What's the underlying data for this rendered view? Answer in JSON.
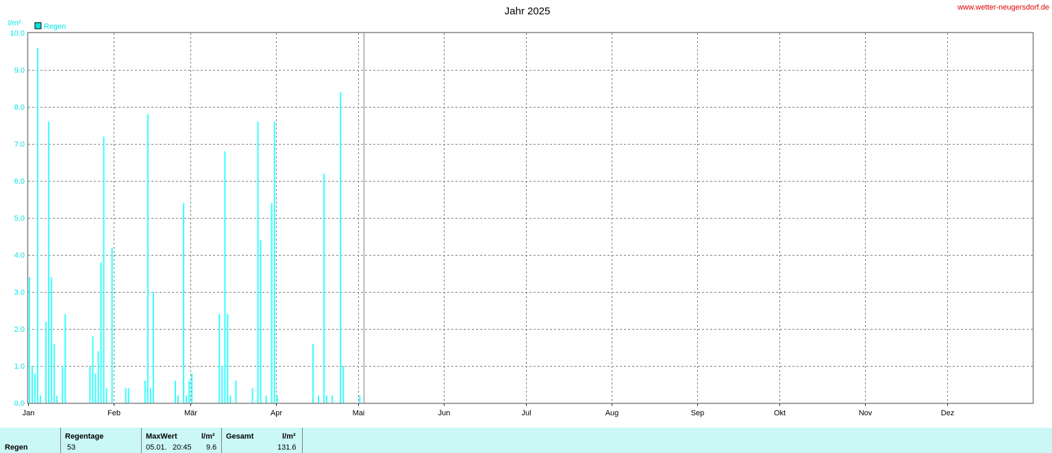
{
  "site": "www.wetter-neugersdorf.de",
  "colors": {
    "bar": "#33ffff",
    "legend_box": "#00e0e0",
    "axis_text": "#00e5e5",
    "grid": "#7f7f7f",
    "stats_bg": "#ccf7f7",
    "site_link": "#e00000"
  },
  "chart_data": {
    "type": "bar",
    "title": "Jahr 2025",
    "ylabel": "l/m²",
    "ylim": [
      0,
      10
    ],
    "yticks": [
      "0.0",
      "1.0",
      "2.0",
      "3.0",
      "4.0",
      "5.0",
      "6.0",
      "7.0",
      "8.0",
      "9.0",
      "10.0"
    ],
    "xlim_days": [
      0,
      365
    ],
    "months": [
      "Jan",
      "Feb",
      "Mär",
      "Apr",
      "Mai",
      "Jun",
      "Jul",
      "Aug",
      "Sep",
      "Okt",
      "Nov",
      "Dez"
    ],
    "month_start_days": [
      0,
      31,
      59,
      90,
      120,
      151,
      181,
      212,
      243,
      273,
      304,
      334
    ],
    "current_day_marker": 122,
    "legend": {
      "label": "Regen",
      "position": "top-left"
    },
    "grid": true,
    "series": [
      {
        "name": "Regen",
        "points": [
          {
            "day": 0.5,
            "value": 3.4
          },
          {
            "day": 1.5,
            "value": 1.0
          },
          {
            "day": 2.5,
            "value": 0.8
          },
          {
            "day": 3.5,
            "value": 9.6
          },
          {
            "day": 4.5,
            "value": 0.2
          },
          {
            "day": 6.5,
            "value": 2.2
          },
          {
            "day": 7.5,
            "value": 7.6
          },
          {
            "day": 8.5,
            "value": 3.4
          },
          {
            "day": 9.5,
            "value": 1.6
          },
          {
            "day": 10.5,
            "value": 0.2
          },
          {
            "day": 12.5,
            "value": 1.0
          },
          {
            "day": 13.5,
            "value": 2.4
          },
          {
            "day": 22.5,
            "value": 1.0
          },
          {
            "day": 23.5,
            "value": 1.8
          },
          {
            "day": 24.5,
            "value": 0.8
          },
          {
            "day": 25.5,
            "value": 1.4
          },
          {
            "day": 26.5,
            "value": 3.8
          },
          {
            "day": 27.5,
            "value": 7.2
          },
          {
            "day": 28.5,
            "value": 0.4
          },
          {
            "day": 30.5,
            "value": 4.2
          },
          {
            "day": 35.5,
            "value": 0.4
          },
          {
            "day": 36.5,
            "value": 0.4
          },
          {
            "day": 42.5,
            "value": 0.6
          },
          {
            "day": 43.5,
            "value": 7.8
          },
          {
            "day": 44.5,
            "value": 0.4
          },
          {
            "day": 45.5,
            "value": 3.0
          },
          {
            "day": 53.5,
            "value": 0.6
          },
          {
            "day": 54.5,
            "value": 0.2
          },
          {
            "day": 56.5,
            "value": 5.4
          },
          {
            "day": 57.5,
            "value": 0.2
          },
          {
            "day": 58.5,
            "value": 0.6
          },
          {
            "day": 59.5,
            "value": 0.8
          },
          {
            "day": 69.5,
            "value": 2.4
          },
          {
            "day": 70.5,
            "value": 1.0
          },
          {
            "day": 71.5,
            "value": 6.8
          },
          {
            "day": 72.5,
            "value": 2.4
          },
          {
            "day": 73.5,
            "value": 0.2
          },
          {
            "day": 75.5,
            "value": 0.6
          },
          {
            "day": 81.5,
            "value": 0.4
          },
          {
            "day": 83.5,
            "value": 7.6
          },
          {
            "day": 84.5,
            "value": 4.4
          },
          {
            "day": 86.5,
            "value": 0.2
          },
          {
            "day": 88.5,
            "value": 5.4
          },
          {
            "day": 89.5,
            "value": 7.6
          },
          {
            "day": 90.5,
            "value": 0.2
          },
          {
            "day": 103.5,
            "value": 1.6
          },
          {
            "day": 105.5,
            "value": 0.2
          },
          {
            "day": 107.5,
            "value": 6.2
          },
          {
            "day": 108.5,
            "value": 0.2
          },
          {
            "day": 110.5,
            "value": 0.2
          },
          {
            "day": 113.5,
            "value": 8.4
          },
          {
            "day": 114.5,
            "value": 1.0
          },
          {
            "day": 120.5,
            "value": 0.2
          }
        ]
      }
    ]
  },
  "stats": {
    "row_label": "Regen",
    "regentage": {
      "header": "Regentage",
      "value": "53"
    },
    "maxwert": {
      "header": "MaxWert",
      "unit": "l/m²",
      "date": "05.01.",
      "time": "20:45",
      "value": "9.6"
    },
    "gesamt": {
      "header": "Gesamt",
      "unit": "l/m²",
      "value": "131.6"
    }
  }
}
